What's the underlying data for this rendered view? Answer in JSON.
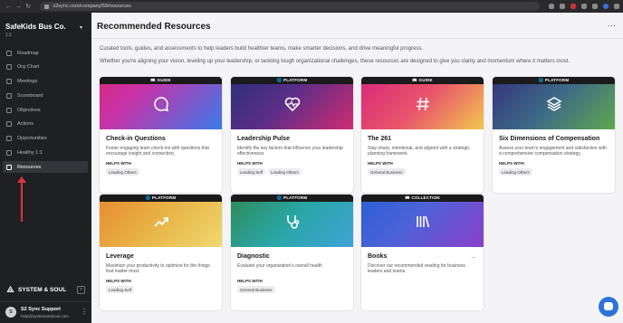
{
  "browser": {
    "url": "s2sync.com/company/59/resources"
  },
  "sidebar": {
    "company_name": "SafeKids Bus Co.",
    "company_sub": "1:1",
    "items": [
      {
        "label": "Roadmap",
        "icon": "roadmap-icon"
      },
      {
        "label": "Org Chart",
        "icon": "org-chart-icon"
      },
      {
        "label": "Meetings",
        "icon": "calendar-icon"
      },
      {
        "label": "Scoreboard",
        "icon": "scoreboard-icon"
      },
      {
        "label": "Objectives",
        "icon": "target-icon"
      },
      {
        "label": "Actions",
        "icon": "checklist-icon"
      },
      {
        "label": "Opportunities",
        "icon": "lightbulb-icon"
      },
      {
        "label": "Healthy 1:1",
        "icon": "heart-icon"
      },
      {
        "label": "Resources",
        "icon": "book-icon"
      }
    ],
    "active_item": "Resources",
    "brand": "SYSTEM & SOUL",
    "user": {
      "initials": "S",
      "name": "S2 Sync Support",
      "email": "help@systemandsoul.com"
    }
  },
  "main": {
    "title": "Recommended Resources",
    "intro_1": "Curated tools, guides, and assessments to help leaders build healthier teams, make smarter decisions, and drive meaningful progress.",
    "intro_2": "Whether you're aligning your vision, leveling up your leadership, or tackling tough organizational challenges, these resources are designed to give you clarity and momentum where it matters most.",
    "helps_label": "HELPS WITH",
    "cards": [
      {
        "tag": "GUIDE",
        "tag_icon": "book-icon",
        "icon": "chat-bubble-icon",
        "title": "Check-in Questions",
        "desc": "Foster engaging team check-ins with questions that encourage insight and connection.",
        "chips": [
          "Leading Others"
        ]
      },
      {
        "tag": "PLATFORM",
        "tag_icon": "globe-icon",
        "icon": "heart-pulse-icon",
        "title": "Leadership Pulse",
        "desc": "Identify the key factors that influence your leadership effectiveness.",
        "chips": [
          "Leading Self",
          "Leading Others"
        ]
      },
      {
        "tag": "GUIDE",
        "tag_icon": "book-icon",
        "icon": "hash-icon",
        "title": "The 261",
        "desc": "Stay sharp, intentional, and aligned with a strategic planning framework.",
        "chips": [
          "General Business"
        ]
      },
      {
        "tag": "PLATFORM",
        "tag_icon": "globe-icon",
        "icon": "layers-icon",
        "title": "Six Dimensions of Compensation",
        "desc": "Assess your team's engagement and satisfaction with a comprehensive compensation strategy.",
        "chips": [
          "Leading Others"
        ]
      },
      {
        "tag": "PLATFORM",
        "tag_icon": "globe-icon",
        "icon": "trend-up-icon",
        "title": "Leverage",
        "desc": "Maximize your productivity to optimize for the things that matter most.",
        "chips": [
          "Leading Self"
        ]
      },
      {
        "tag": "PLATFORM",
        "tag_icon": "globe-icon",
        "icon": "stethoscope-icon",
        "title": "Diagnostic",
        "desc": "Evaluate your organization's overall health",
        "chips": [
          "General Business"
        ]
      },
      {
        "tag": "COLLECTION",
        "tag_icon": "book-open-icon",
        "icon": "library-icon",
        "title": "Books",
        "desc": "Discover our recommended reading for business leaders and teams.",
        "chips": []
      }
    ]
  }
}
